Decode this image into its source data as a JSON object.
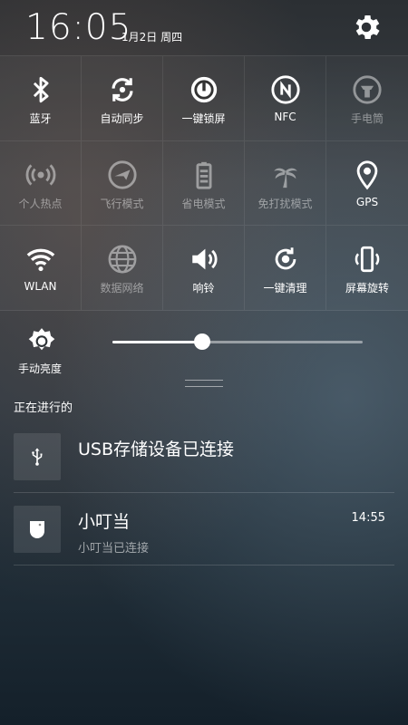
{
  "status": {
    "time": "16:05",
    "date": "1月2日 周四"
  },
  "tiles": [
    {
      "label": "蓝牙",
      "icon": "bluetooth-icon",
      "active": true
    },
    {
      "label": "自动同步",
      "icon": "sync-icon",
      "active": true
    },
    {
      "label": "一键锁屏",
      "icon": "lock-screen-icon",
      "active": true
    },
    {
      "label": "NFC",
      "icon": "nfc-icon",
      "active": true
    },
    {
      "label": "手电筒",
      "icon": "flashlight-icon",
      "active": false
    },
    {
      "label": "个人热点",
      "icon": "hotspot-icon",
      "active": false
    },
    {
      "label": "飞行模式",
      "icon": "airplane-icon",
      "active": false
    },
    {
      "label": "省电模式",
      "icon": "battery-icon",
      "active": false
    },
    {
      "label": "免打扰模式",
      "icon": "palm-tree-icon",
      "active": false
    },
    {
      "label": "GPS",
      "icon": "location-pin-icon",
      "active": true
    },
    {
      "label": "WLAN",
      "icon": "wifi-icon",
      "active": true
    },
    {
      "label": "数据网络",
      "icon": "globe-icon",
      "active": false
    },
    {
      "label": "响铃",
      "icon": "speaker-icon",
      "active": true
    },
    {
      "label": "一键清理",
      "icon": "clean-icon",
      "active": true
    },
    {
      "label": "屏幕旋转",
      "icon": "rotate-screen-icon",
      "active": true
    }
  ],
  "brightness": {
    "label": "手动亮度",
    "level": 0.36
  },
  "notifications": {
    "section_title": "正在进行的",
    "items": [
      {
        "title": "USB存储设备已连接",
        "subtitle": "",
        "time": "",
        "icon": "usb-icon"
      },
      {
        "title": "小叮当",
        "subtitle": "小叮当已连接",
        "time": "14:55",
        "icon": "device-icon"
      }
    ]
  }
}
